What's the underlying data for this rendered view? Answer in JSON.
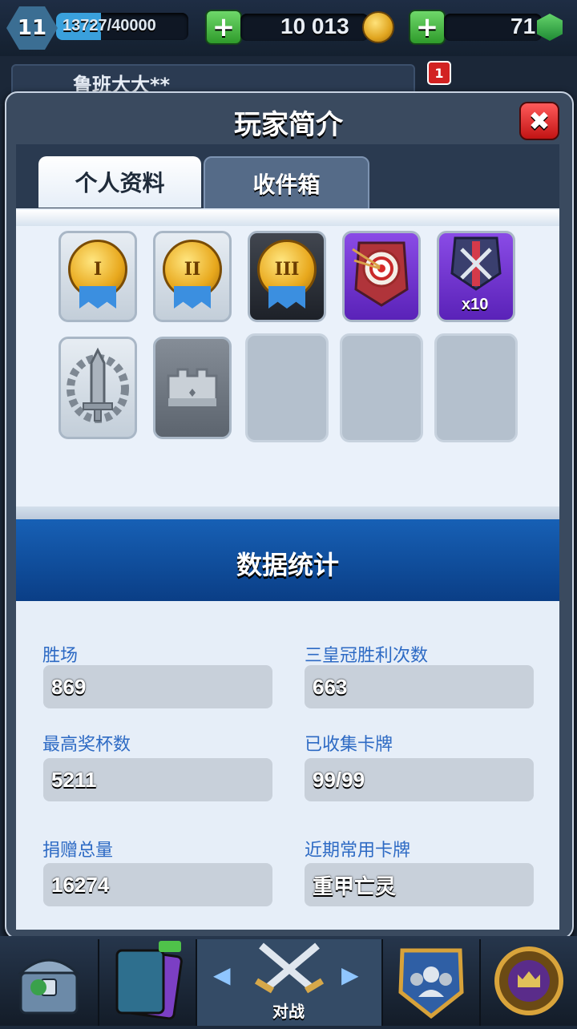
{
  "top_bar": {
    "level": "11",
    "xp_text": "13727/40000",
    "xp_progress": 0.34,
    "gold": "10 013",
    "gems": "71",
    "add_gold_icon": "plus-icon",
    "add_gems_icon": "plus-icon",
    "gold_icon": "coin-icon",
    "gem_icon": "gem-icon"
  },
  "behind_modal": {
    "player_name": "鲁班大大**",
    "notification_count": "1"
  },
  "modal": {
    "title": "玩家简介",
    "close_icon": "close-icon",
    "tabs": [
      {
        "label": "个人资料",
        "active": true
      },
      {
        "label": "收件箱",
        "active": false
      }
    ],
    "badges": [
      {
        "icon": "gold-medal-i-icon",
        "numeral": "I",
        "style": "silver"
      },
      {
        "icon": "gold-medal-ii-icon",
        "numeral": "II",
        "style": "silver"
      },
      {
        "icon": "gold-medal-iii-icon",
        "numeral": "III",
        "style": "black"
      },
      {
        "icon": "target-arrows-icon",
        "style": "purple"
      },
      {
        "icon": "crossed-swords-icon",
        "style": "purple",
        "count": "x10"
      },
      {
        "icon": "silver-sword-laurel-icon",
        "style": "silver"
      },
      {
        "icon": "silver-crown-icon",
        "style": "grey"
      },
      {
        "style": "empty"
      },
      {
        "style": "empty"
      },
      {
        "style": "empty"
      }
    ],
    "stats_title": "数据统计",
    "stats": [
      {
        "label": "胜场",
        "value": "869"
      },
      {
        "label": "三皇冠胜利次数",
        "value": "663"
      },
      {
        "label": "最高奖杯数",
        "value": "5211"
      },
      {
        "label": "已收集卡牌",
        "value": "99/99"
      },
      {
        "label": "捐赠总量",
        "value": "16274"
      },
      {
        "label": "近期常用卡牌",
        "value": "重甲亡灵"
      }
    ]
  },
  "bottom_nav": {
    "items": [
      {
        "icon": "treasure-chest-icon"
      },
      {
        "icon": "cards-icon"
      },
      {
        "icon": "crossed-swords-icon",
        "label": "对战",
        "active": true
      },
      {
        "icon": "clan-icon"
      },
      {
        "icon": "tournament-crown-icon"
      }
    ]
  },
  "colors": {
    "accent_blue": "#2d6ac4",
    "banner_blue": "#1760b5",
    "close_red": "#e02020",
    "plus_green": "#3bb33a"
  }
}
